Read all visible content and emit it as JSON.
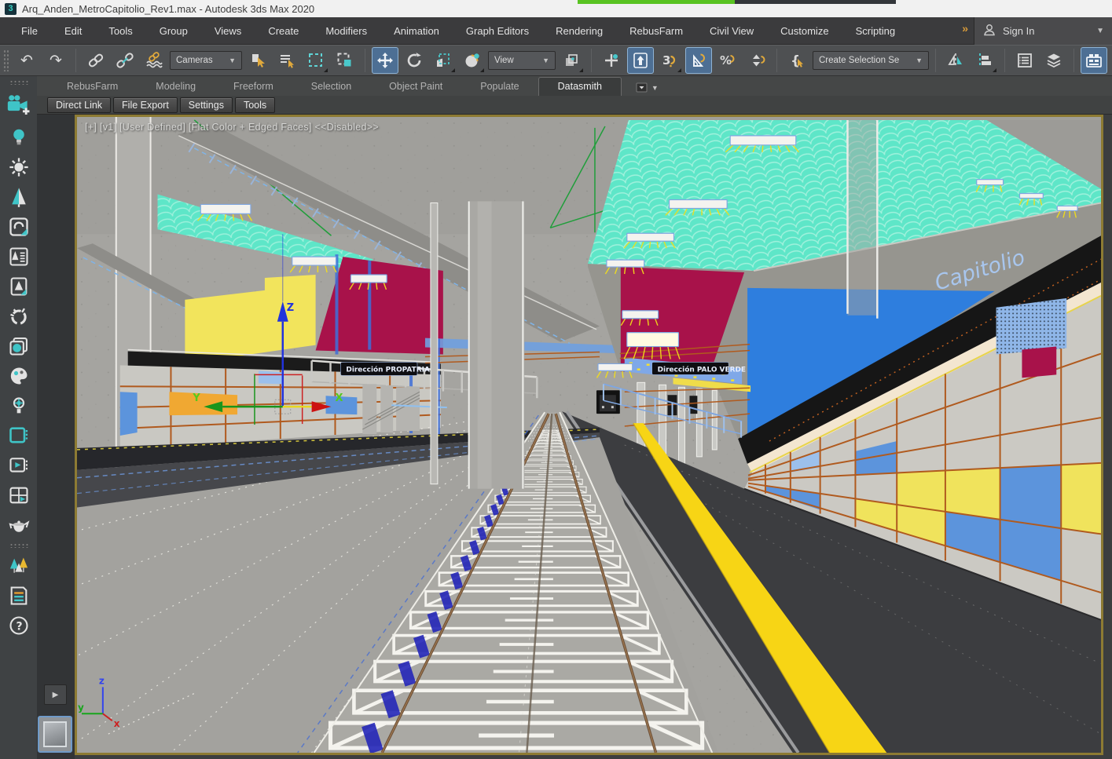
{
  "title_bar": {
    "app_logo": "3",
    "title": "Arq_Anden_MetroCapitolio_Rev1.max - Autodesk 3ds Max 2020"
  },
  "menu_bar": {
    "items": [
      "File",
      "Edit",
      "Tools",
      "Group",
      "Views",
      "Create",
      "Modifiers",
      "Animation",
      "Graph Editors",
      "Rendering",
      "RebusFarm",
      "Civil View",
      "Customize",
      "Scripting"
    ],
    "overflow_indicator": "»",
    "sign_in_label": "Sign In"
  },
  "toolbar": {
    "selection_filter_value": "Cameras",
    "coordinate_system_value": "View",
    "selection_set_field": "Create Selection Se",
    "active_tools": [
      "select-and-move",
      "keyboard-shortcut-override",
      "angle-snap",
      "toggle-ribbon"
    ],
    "icons": [
      "undo",
      "redo",
      "select-and-link",
      "unlink-selection",
      "bind-to-space-warp",
      "selection-filter",
      "select-object",
      "select-by-name",
      "rectangular-selection-region",
      "window-crossing",
      "select-and-move",
      "select-and-rotate",
      "select-and-scale",
      "select-and-place",
      "reference-coordinate-system",
      "use-pivot-center",
      "select-and-manipulate",
      "keyboard-shortcut-override",
      "snaps-toggle",
      "angle-snap",
      "percent-snap",
      "spinner-snap",
      "edit-named-selection-sets",
      "named-selection-sets",
      "mirror",
      "align",
      "toggle-scene-explorer",
      "toggle-layer-explorer",
      "toggle-ribbon"
    ]
  },
  "ribbon": {
    "tabs": [
      "RebusFarm",
      "Modeling",
      "Freeform",
      "Selection",
      "Object Paint",
      "Populate",
      "Datasmith"
    ],
    "active_tab": "Datasmith",
    "panel_buttons": [
      "Direct Link",
      "File Export",
      "Settings",
      "Tools"
    ]
  },
  "left_toolbar": {
    "icons": [
      "create-camera",
      "light-bulb",
      "sun",
      "tree",
      "environment",
      "plant-library",
      "plant-page",
      "fire-ring",
      "material-sphere",
      "palette",
      "light-settings",
      "display-panel",
      "preview-monitor",
      "split-view",
      "render-teapot",
      "forest",
      "notes-document",
      "help"
    ]
  },
  "viewport": {
    "label": "[+] [v1] [User Defined] [Flat Color + Edged Faces]   <<Disabled>>",
    "layout_expand_glyph": "▶",
    "scene": {
      "station_sign": "Capitolio",
      "station_sign_small": "Capitolio",
      "direction_sign_left": "Dirección PROPATRIA",
      "direction_sign_right": "Dirección PALO VERDE",
      "gizmo_axis_x": "X",
      "gizmo_axis_y": "Y",
      "gizmo_axis_z": "Z",
      "world_axis_x": "x",
      "world_axis_y": "y",
      "world_axis_z": "z"
    }
  },
  "colors": {
    "accent_teal": "#3fc4c7",
    "active_tool_blue": "#4d6f94",
    "viewport_border": "#8d7b33",
    "ceiling_teal": "#5ee6c8",
    "wall_crimson": "#a8124a",
    "panel_yellow": "#f2e45c",
    "panel_blue": "#2e7ede",
    "station_band_black": "#161616",
    "band_cream": "#f3e6d0",
    "tile_grey": "#cbc9c3",
    "tile_blue": "#5c94dc",
    "tile_yellow": "#f0e35c",
    "tile_amber": "#f0a832",
    "grid_orange": "#b05a1e",
    "platform_dark": "#3c3d40",
    "warning_yellow": "#f7d515",
    "rail_brown": "#7b5a3f",
    "sign_text_blue": "#a8c6ee",
    "progress_green": "#59c322"
  }
}
